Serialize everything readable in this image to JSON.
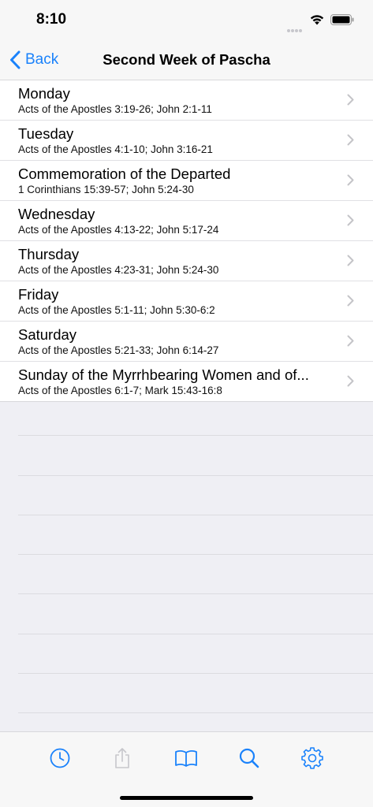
{
  "status_bar": {
    "time": "8:10"
  },
  "nav": {
    "back_label": "Back",
    "title": "Second Week of Pascha"
  },
  "rows": [
    {
      "title": "Monday",
      "subtitle": "Acts of the Apostles 3:19-26; John 2:1-11"
    },
    {
      "title": "Tuesday",
      "subtitle": "Acts of the Apostles 4:1-10; John 3:16-21"
    },
    {
      "title": "Commemoration of the Departed",
      "subtitle": "1 Corinthians 15:39-57; John 5:24-30"
    },
    {
      "title": "Wednesday",
      "subtitle": "Acts of the Apostles 4:13-22; John 5:17-24"
    },
    {
      "title": "Thursday",
      "subtitle": "Acts of the Apostles 4:23-31; John 5:24-30"
    },
    {
      "title": "Friday",
      "subtitle": "Acts of the Apostles 5:1-11; John 5:30-6:2"
    },
    {
      "title": "Saturday",
      "subtitle": "Acts of the Apostles 5:21-33; John 6:14-27"
    },
    {
      "title": "Sunday of the Myrrhbearing Women and of...",
      "subtitle": "Acts of the Apostles 6:1-7; Mark 15:43-16:8"
    }
  ],
  "tab_bar": {
    "tabs": [
      {
        "icon": "clock-icon"
      },
      {
        "icon": "share-icon"
      },
      {
        "icon": "book-icon"
      },
      {
        "icon": "search-icon"
      },
      {
        "icon": "gear-icon"
      }
    ]
  },
  "colors": {
    "accent": "#1a82fb",
    "disabled": "#c7c7cc",
    "background": "#efeff4"
  }
}
